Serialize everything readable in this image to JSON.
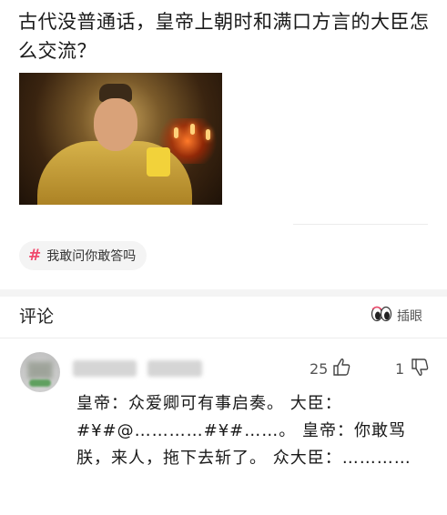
{
  "post": {
    "title": "古代没普通话，皇帝上朝时和满口方言的大臣怎么交流？",
    "tag_symbol": "#",
    "tag_label": "我敢问你敢答吗"
  },
  "comments_section": {
    "title": "评论",
    "sort_label": "插眼"
  },
  "comment": {
    "like_count": "25",
    "dislike_count": "1",
    "text": "皇帝：众爱卿可有事启奏。  大臣：#¥#@…………#¥#……。  皇帝：你敢骂朕，来人，拖下去斩了。   众大臣：…………"
  },
  "colors": {
    "tag_hash": "#f04a6d",
    "divider": "#f4f4f4"
  }
}
